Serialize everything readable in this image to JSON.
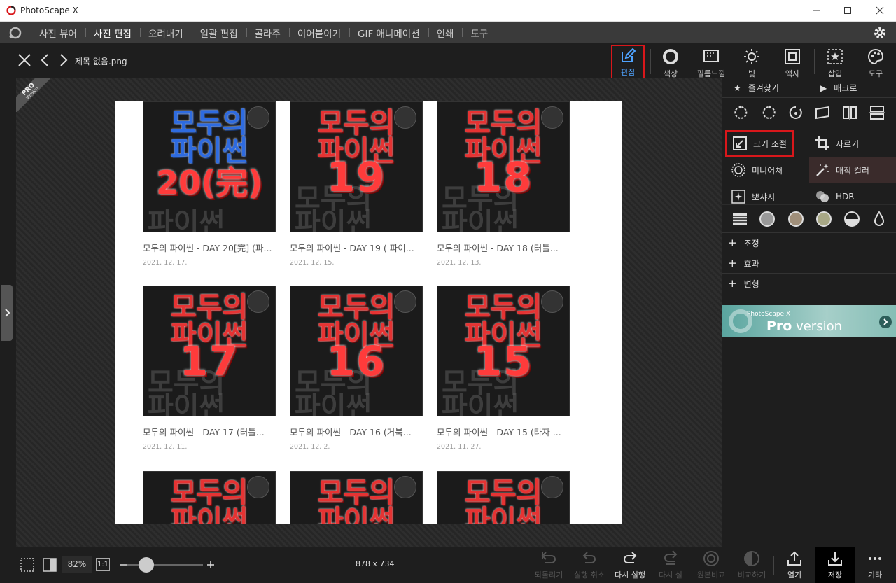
{
  "app": {
    "title": "PhotoScape X"
  },
  "menu": {
    "items": [
      "사진 뷰어",
      "사진 편집",
      "오려내기",
      "일괄 편집",
      "콜라주",
      "이어붙이기",
      "GIF 애니메이션",
      "인쇄",
      "도구"
    ],
    "active": "사진 편집"
  },
  "editor": {
    "filename": "제목 없음.png",
    "tabs": [
      "편집",
      "색상",
      "필름느낌",
      "빛",
      "액자",
      "삽입",
      "도구"
    ],
    "pro_badge": {
      "line1": "PRO",
      "line2": "Version"
    }
  },
  "cards": [
    {
      "caption": "모두의 파이썬 - DAY 20[完] (파...",
      "date": "2021. 12. 17.",
      "number": "20(完)",
      "title1": "모두의",
      "title2": "파이썬"
    },
    {
      "caption": "모두의 파이썬 - DAY 19 ( 파이...",
      "date": "2021. 12. 15.",
      "number": "19",
      "title1": "모두의",
      "title2": "파이썬"
    },
    {
      "caption": "모두의 파이썬 - DAY 18 (터틀...",
      "date": "2021. 12. 13.",
      "number": "18",
      "title1": "모두의",
      "title2": "파이썬"
    },
    {
      "caption": "모두의 파이썬 - DAY 17 (터틀...",
      "date": "2021. 12. 11.",
      "number": "17",
      "title1": "모두의",
      "title2": "파이썬"
    },
    {
      "caption": "모두의 파이썬 - DAY 16 (거북...",
      "date": "2021. 12. 2.",
      "number": "16",
      "title1": "모두의",
      "title2": "파이썬"
    },
    {
      "caption": "모두의 파이썬 - DAY 15 (타자 ...",
      "date": "2021. 11. 27.",
      "number": "15",
      "title1": "모두의",
      "title2": "파이썬"
    },
    {
      "title1": "모두의",
      "title2": "파이썬"
    },
    {
      "title1": "모두의",
      "title2": "파이썬"
    },
    {
      "title1": "모두의",
      "title2": "파이썬"
    }
  ],
  "panel": {
    "favorites": "즐겨찾기",
    "macro": "매크로",
    "tools": {
      "resize": "크기 조절",
      "crop": "자르기",
      "miniature": "미니어처",
      "magic_color": "매직 컬러",
      "bokeh": "뽀샤시",
      "hdr": "HDR"
    },
    "sections": [
      "조정",
      "효과",
      "변형"
    ],
    "promo": {
      "line1": "PhotoScape X",
      "pro": "Pro",
      "version": " version"
    }
  },
  "bottom": {
    "zoom": "82%",
    "one_to_one": "1:1",
    "dimensions": "878 x 734",
    "actions": [
      {
        "label": "되돌리기",
        "enabled": false
      },
      {
        "label": "실행 취소",
        "enabled": false
      },
      {
        "label": "다시 실행",
        "enabled": true
      },
      {
        "label": "다시 실",
        "enabled": false
      },
      {
        "label": "원본비교",
        "enabled": false
      },
      {
        "label": "비교하기",
        "enabled": false
      },
      {
        "label": "열기",
        "enabled": true
      },
      {
        "label": "저장",
        "enabled": true
      },
      {
        "label": "기타",
        "enabled": true
      }
    ]
  },
  "colors": {
    "accent_red": "#d9171b",
    "edit_blue": "#4fa3ff",
    "panel_bg": "#1e1e1e"
  }
}
